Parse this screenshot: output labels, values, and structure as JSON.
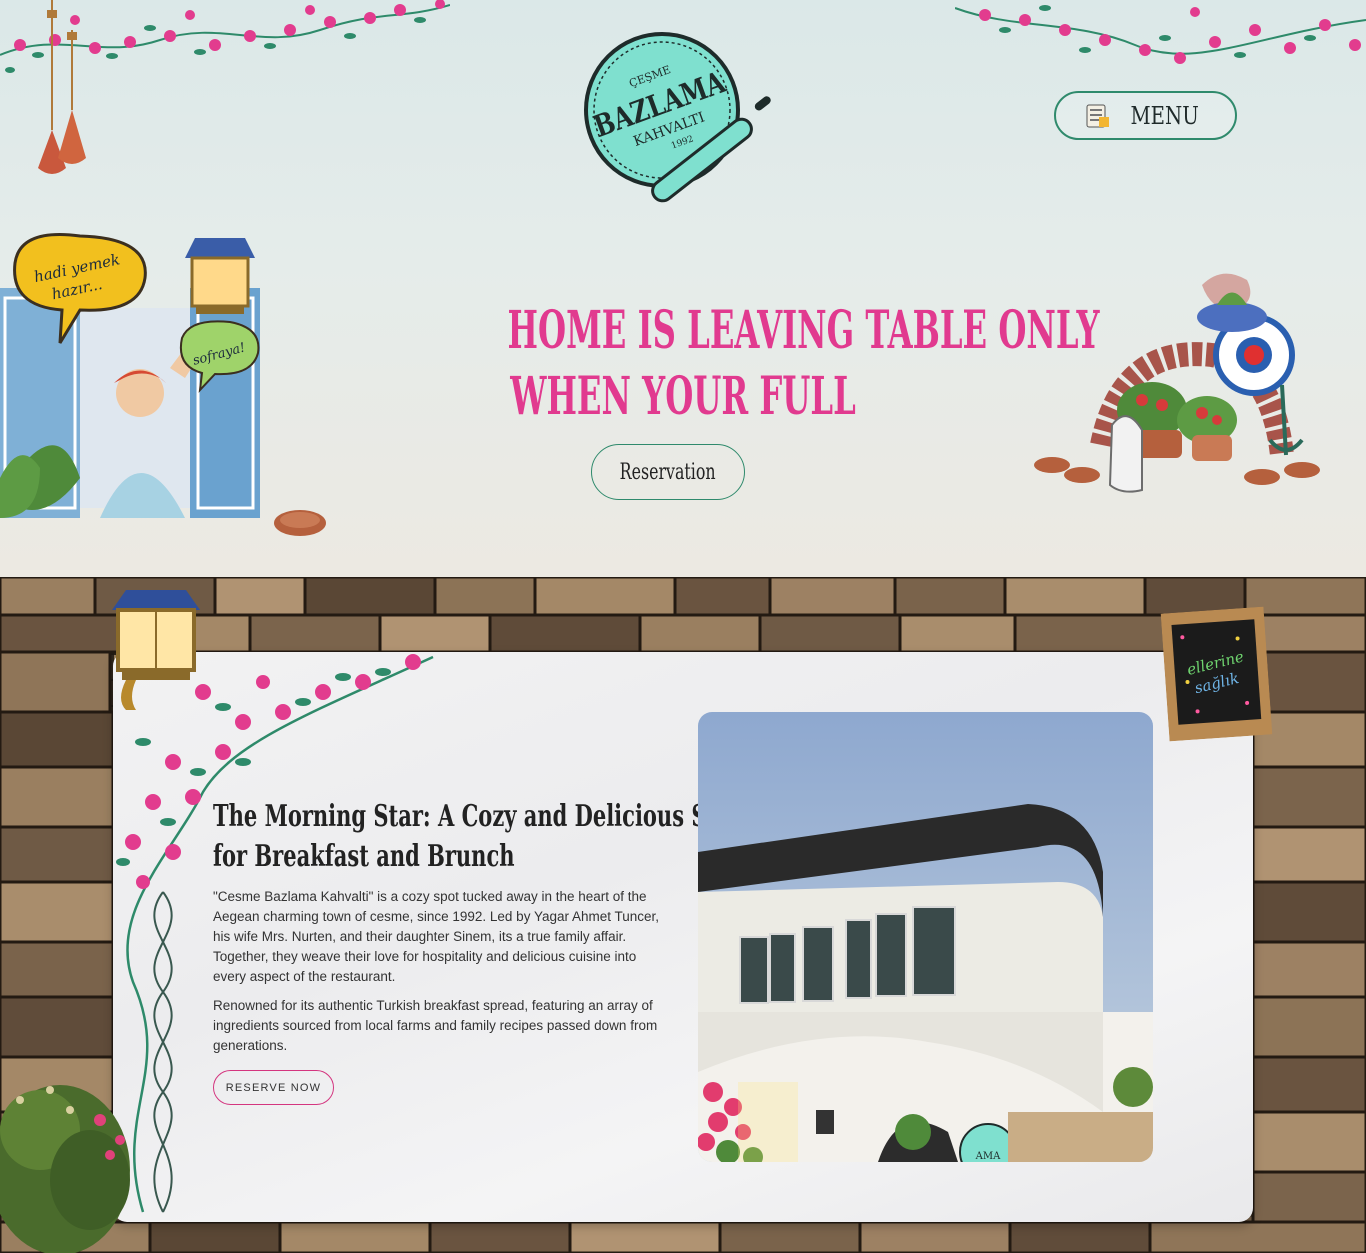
{
  "brand": {
    "logo_top": "ÇEŞME",
    "logo_main": "BAZLAMA",
    "logo_sub": "KAHVALTI",
    "logo_year": "1992",
    "colors": {
      "pink": "#e13a8f",
      "green": "#2f8a6c",
      "mint": "#7fe0cf"
    }
  },
  "header": {
    "menu_label": "MENU",
    "menu_icon": "menu-card-icon"
  },
  "hero": {
    "title_line1": "HOME IS LEAVING TABLE ONLY",
    "title_line2": "WHEN YOUR FULL",
    "reservation_label": "Reservation",
    "bubble1_line1": "hadi yemek",
    "bubble1_line2": "hazır...",
    "bubble2": "sofraya!"
  },
  "about": {
    "title_line1": "The Morning Star: A Cozy and Delicious Spot",
    "title_line2": "for Breakfast and Brunch",
    "paragraph1": "\"Cesme Bazlama Kahvalti\" is a cozy spot tucked away in the heart of the Aegean charming town of cesme, since 1992. Led by Yagar Ahmet Tuncer, his wife Mrs. Nurten, and their daughter Sinem, its a true family affair. Together, they weave their love for hospitality and delicious cuisine into every aspect of the restaurant.",
    "paragraph2": "Renowned for its authentic Turkish breakfast spread, featuring an array of ingredients sourced from local farms and family recipes passed down from generations.",
    "reserve_label": "RESERVE NOW",
    "chalkboard_line1": "ellerine",
    "chalkboard_line2": "sağlık",
    "photo_sign": "AMA"
  }
}
